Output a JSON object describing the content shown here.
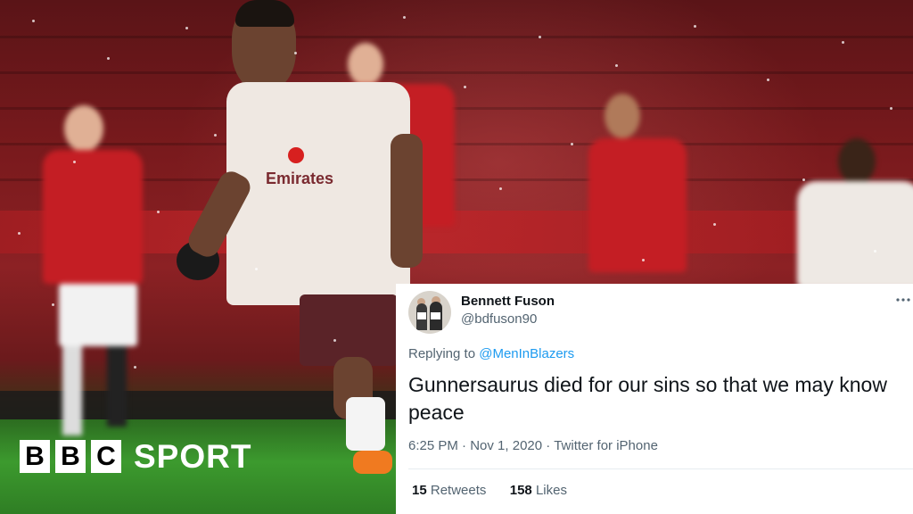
{
  "branding": {
    "logo_blocks": [
      "B",
      "B",
      "C"
    ],
    "logo_text": "SPORT"
  },
  "tweet": {
    "display_name": "Bennett Fuson",
    "handle": "@bdfuson90",
    "more_icon": "more-icon",
    "replying_prefix": "Replying to",
    "replying_to": "@MenInBlazers",
    "text": "Gunnersaurus died for our sins so that we may know peace",
    "time": "6:25 PM",
    "date": "Nov 1, 2020",
    "source": "Twitter for iPhone",
    "retweets_count": "15",
    "retweets_label": "Retweets",
    "likes_count": "158",
    "likes_label": "Likes"
  },
  "colors": {
    "link": "#1d9bf0",
    "muted": "#536471",
    "text": "#0f1419"
  }
}
